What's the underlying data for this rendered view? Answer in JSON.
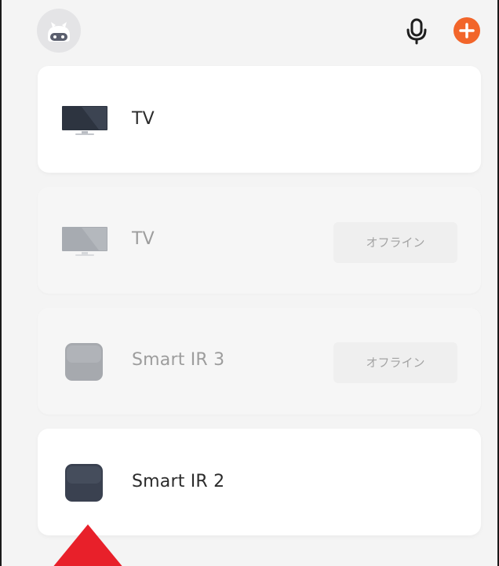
{
  "header": {
    "avatar_icon": "robot-avatar-icon",
    "mic_icon": "microphone-icon",
    "add_icon": "plus-icon",
    "accent_color": "#f2652a"
  },
  "devices": [
    {
      "name": "TV",
      "type": "tv",
      "status": "",
      "online": true
    },
    {
      "name": "TV",
      "type": "tv",
      "status": "オフライン",
      "online": false
    },
    {
      "name": "Smart IR 3",
      "type": "ir-hub",
      "status": "オフライン",
      "online": false
    },
    {
      "name": "Smart IR 2",
      "type": "ir-hub",
      "status": "",
      "online": true
    }
  ],
  "annotation": {
    "pointer_icon": "red-up-arrow-icon",
    "pointer_color": "#e8202a"
  }
}
